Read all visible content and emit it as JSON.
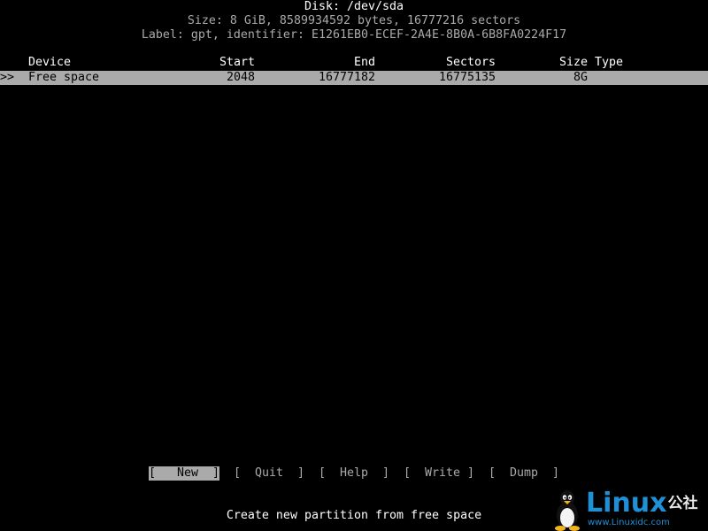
{
  "disk": {
    "title": "Disk: /dev/sda",
    "size_line": "Size: 8 GiB, 8589934592 bytes, 16777216 sectors",
    "label_line": "Label: gpt, identifier: E1261EB0-ECEF-2A4E-8B0A-6B8FA0224F17"
  },
  "table": {
    "headers": {
      "device": "Device",
      "start": "Start",
      "end": "End",
      "sectors": "Sectors",
      "size": "Size",
      "type": "Type"
    },
    "rows": [
      {
        "marker": ">>",
        "device": "Free space",
        "start": "2048",
        "end": "16777182",
        "sectors": "16775135",
        "size": "8G",
        "type": ""
      }
    ]
  },
  "menu": {
    "selected": "New",
    "buttons": [
      {
        "label": "New"
      },
      {
        "label": "Quit"
      },
      {
        "label": "Help"
      },
      {
        "label": "Write"
      },
      {
        "label": "Dump"
      }
    ]
  },
  "hint": "Create new partition from free space",
  "watermark": {
    "brand": "Linux",
    "brand_cn": "公社",
    "url": "www.Linuxidc.com"
  }
}
